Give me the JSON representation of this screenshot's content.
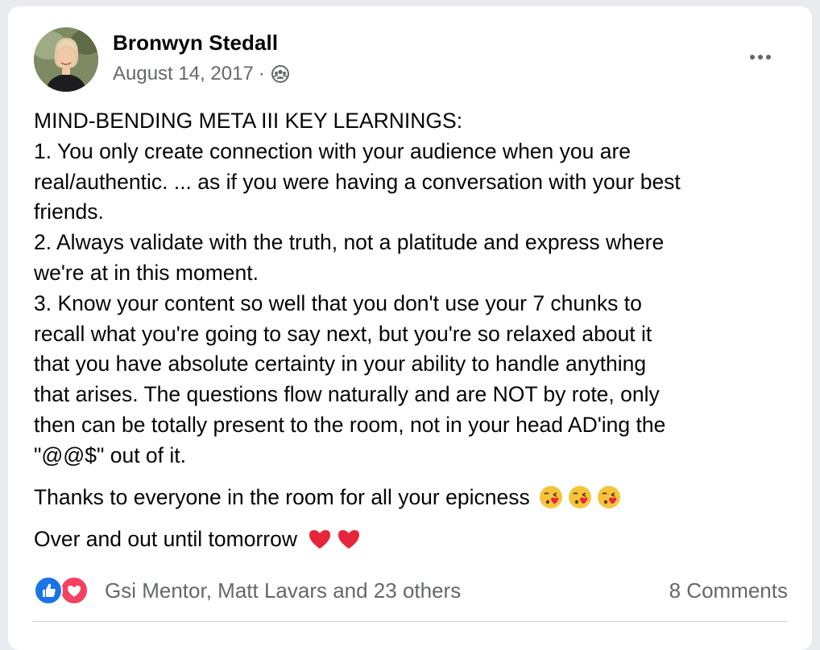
{
  "post": {
    "author": "Bronwyn Stedall",
    "date": "August 14, 2017",
    "separator": "·",
    "audience_icon": "friends-icon",
    "more_icon": "more-options-icon"
  },
  "content": {
    "lines": [
      "MIND-BENDING META III KEY LEARNINGS:",
      "1. You only create connection with your audience when you are",
      "real/authentic. ... as if you were having a conversation with your best",
      "friends.",
      "2. Always validate with the truth, not a platitude and express where",
      "we're at in this moment.",
      "3. Know your content so well that you don't use your 7 chunks to",
      "recall what you're going to say next, but you're so relaxed about it",
      "that you have absolute certainty in your ability to handle anything",
      "that arises. The questions flow naturally and are NOT by rote, only",
      "then can be totally present to the room, not in your head AD'ing the",
      "\"@@$\" out of it."
    ],
    "thanks": "Thanks to everyone in the room for all your epicness",
    "thanks_emoji": "face-blowing-kiss-emoji",
    "signoff": "Over and out until tomorrow",
    "signoff_emoji": "red-heart-emoji"
  },
  "footer": {
    "reactions": [
      "like-icon",
      "love-icon"
    ],
    "reactors": "Gsi Mentor, Matt Lavars and 23 others",
    "comments": "8 Comments"
  },
  "colors": {
    "like": "#1b74e4",
    "love": "#f3425f",
    "secondary_text": "#65676b",
    "primary_text": "#050505"
  }
}
